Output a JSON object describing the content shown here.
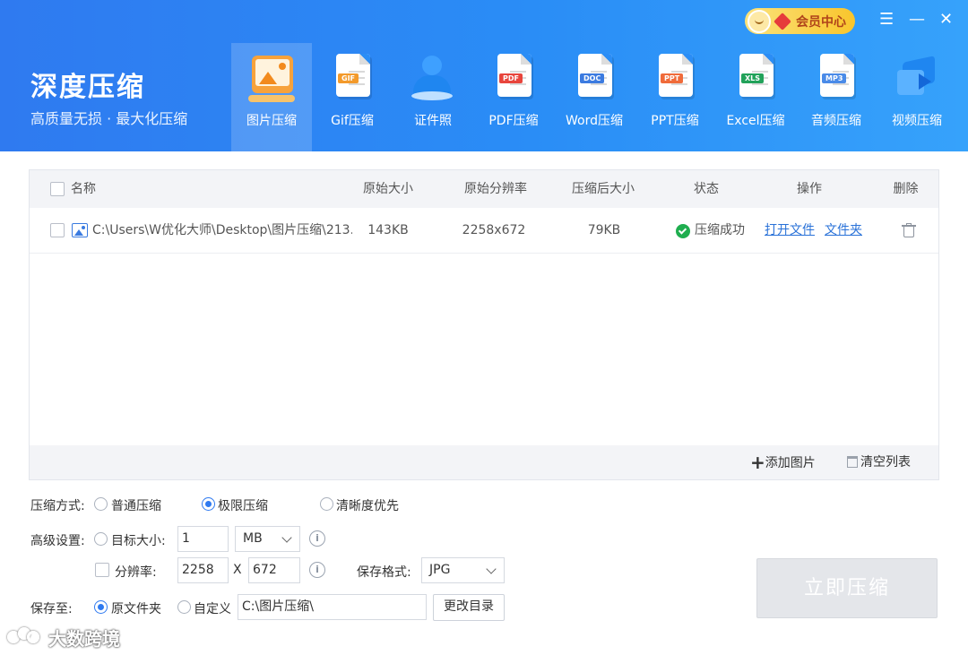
{
  "brand": {
    "title": "深度压缩",
    "subtitle": "高质量无损 · 最大化压缩"
  },
  "member": {
    "label": "会员中心"
  },
  "window_controls": {
    "menu": "☰",
    "minimize": "—",
    "close": "✕"
  },
  "tabs": [
    {
      "label": "图片压缩",
      "icon": "image-compress-icon",
      "active": true
    },
    {
      "label": "Gif压缩",
      "icon": "gif-file-icon",
      "badge": "GIF",
      "color": "#f39a2b"
    },
    {
      "label": "证件照",
      "icon": "id-photo-icon"
    },
    {
      "label": "PDF压缩",
      "icon": "pdf-file-icon",
      "badge": "PDF",
      "color": "#e8453c"
    },
    {
      "label": "Word压缩",
      "icon": "word-file-icon",
      "badge": "DOC",
      "color": "#3c7be0"
    },
    {
      "label": "PPT压缩",
      "icon": "ppt-file-icon",
      "badge": "PPT",
      "color": "#f06b3a"
    },
    {
      "label": "Excel压缩",
      "icon": "excel-file-icon",
      "badge": "XLS",
      "color": "#22a25a"
    },
    {
      "label": "音频压缩",
      "icon": "audio-file-icon",
      "badge": "MP3",
      "color": "#4a8be8"
    },
    {
      "label": "视频压缩",
      "icon": "video-file-icon"
    }
  ],
  "table": {
    "headers": {
      "name": "名称",
      "orig_size": "原始大小",
      "orig_res": "原始分辨率",
      "new_size": "压缩后大小",
      "status": "状态",
      "action": "操作",
      "delete": "删除"
    },
    "rows": [
      {
        "name": "C:\\Users\\W优化大师\\Desktop\\图片压缩\\213....",
        "orig_size": "143KB",
        "orig_res": "2258x672",
        "new_size": "79KB",
        "status": "压缩成功",
        "open_file": "打开文件",
        "open_folder": "文件夹"
      }
    ],
    "footer": {
      "add": "添加图片",
      "clear": "清空列表"
    }
  },
  "settings": {
    "mode_label": "压缩方式:",
    "modes": [
      "普通压缩",
      "极限压缩",
      "清晰度优先"
    ],
    "selected_mode": "极限压缩",
    "advanced_label": "高级设置:",
    "target_size_label": "目标大小:",
    "target_size_value": "1",
    "target_unit": "MB",
    "resolution_label": "分辨率:",
    "res_width": "2258",
    "res_x": "X",
    "res_height": "672",
    "format_label": "保存格式:",
    "format_value": "JPG",
    "save_label": "保存至:",
    "save_options": [
      "原文件夹",
      "自定义"
    ],
    "selected_save": "原文件夹",
    "save_path": "C:\\图片压缩\\",
    "change_dir": "更改目录",
    "compress_now": "立即压缩"
  },
  "watermark": {
    "text": "大数跨境"
  },
  "colors": {
    "accent": "#2f7af0",
    "success": "#1fae4f",
    "link": "#2a72d8"
  }
}
